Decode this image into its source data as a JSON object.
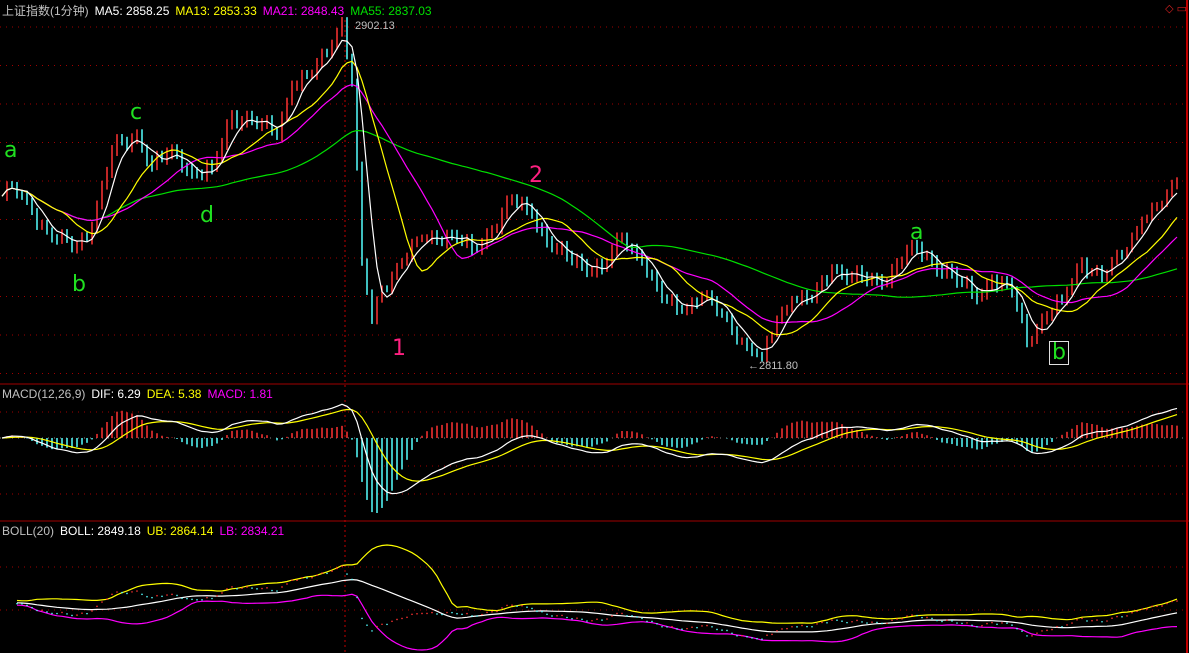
{
  "header": {
    "title": "上证指数(1分钟)",
    "ma5": "MA5: 2858.25",
    "ma13": "MA13: 2853.33",
    "ma21": "MA21: 2848.43",
    "ma55": "MA55: 2837.03"
  },
  "macd_header": {
    "name": "MACD(12,26,9)",
    "dif": "DIF: 6.29",
    "dea": "DEA: 5.38",
    "macd": "MACD: 1.81"
  },
  "boll_header": {
    "name": "BOLL(20)",
    "boll": "BOLL: 2849.18",
    "ub": "UB: 2864.14",
    "lb": "LB: 2834.21"
  },
  "price_marks": {
    "high": "2902.13",
    "low": "2811.80"
  },
  "annotations": [
    {
      "text": "a",
      "color": "#20e020"
    },
    {
      "text": "b",
      "color": "#20e020"
    },
    {
      "text": "c",
      "color": "#20e020"
    },
    {
      "text": "d",
      "color": "#20e020"
    },
    {
      "text": "1",
      "color": "#ff2080"
    },
    {
      "text": "2",
      "color": "#ff2080"
    },
    {
      "text": "a",
      "color": "#20e020"
    },
    {
      "text": "b",
      "color": "#20e020"
    }
  ],
  "colors": {
    "up": "#ff3232",
    "down": "#54ffff",
    "ma5": "#ffffff",
    "ma13": "#ffff00",
    "ma21": "#ff00ff",
    "ma55": "#00e000",
    "grid": "#a00000"
  },
  "chart_data": {
    "type": "line",
    "title": "上证指数(1分钟)",
    "price_range": [
      2811.8,
      2902.13
    ],
    "close_keypoints": [
      [
        0,
        2856
      ],
      [
        2,
        2859
      ],
      [
        6,
        2852
      ],
      [
        10,
        2845
      ],
      [
        15,
        2843
      ],
      [
        18,
        2848
      ],
      [
        22,
        2868
      ],
      [
        27,
        2872
      ],
      [
        30,
        2864
      ],
      [
        34,
        2868
      ],
      [
        38,
        2862
      ],
      [
        42,
        2863
      ],
      [
        46,
        2877
      ],
      [
        52,
        2875
      ],
      [
        55,
        2872
      ],
      [
        58,
        2885
      ],
      [
        62,
        2888
      ],
      [
        66,
        2896
      ],
      [
        68,
        2902
      ],
      [
        70,
        2886
      ],
      [
        72,
        2839
      ],
      [
        74,
        2824
      ],
      [
        76,
        2832
      ],
      [
        80,
        2839
      ],
      [
        84,
        2845
      ],
      [
        90,
        2846
      ],
      [
        94,
        2842
      ],
      [
        98,
        2847
      ],
      [
        102,
        2855
      ],
      [
        106,
        2851
      ],
      [
        110,
        2842
      ],
      [
        116,
        2838
      ],
      [
        120,
        2837
      ],
      [
        124,
        2845
      ],
      [
        128,
        2839
      ],
      [
        132,
        2829
      ],
      [
        136,
        2826
      ],
      [
        140,
        2830
      ],
      [
        144,
        2825
      ],
      [
        149,
        2817
      ],
      [
        152,
        2814
      ],
      [
        155,
        2824
      ],
      [
        158,
        2829
      ],
      [
        162,
        2829
      ],
      [
        166,
        2837
      ],
      [
        170,
        2835
      ],
      [
        176,
        2833
      ],
      [
        182,
        2843
      ],
      [
        186,
        2839
      ],
      [
        192,
        2833
      ],
      [
        195,
        2829
      ],
      [
        198,
        2834
      ],
      [
        202,
        2831
      ],
      [
        205,
        2818
      ],
      [
        208,
        2824
      ],
      [
        212,
        2829
      ],
      [
        216,
        2839
      ],
      [
        220,
        2835
      ],
      [
        224,
        2841
      ],
      [
        228,
        2850
      ],
      [
        232,
        2854
      ],
      [
        235,
        2860
      ]
    ],
    "series": [
      "MA5",
      "MA13",
      "MA21",
      "MA55"
    ],
    "indicators": [
      "MACD(12,26,9)",
      "BOLL(20)"
    ]
  }
}
